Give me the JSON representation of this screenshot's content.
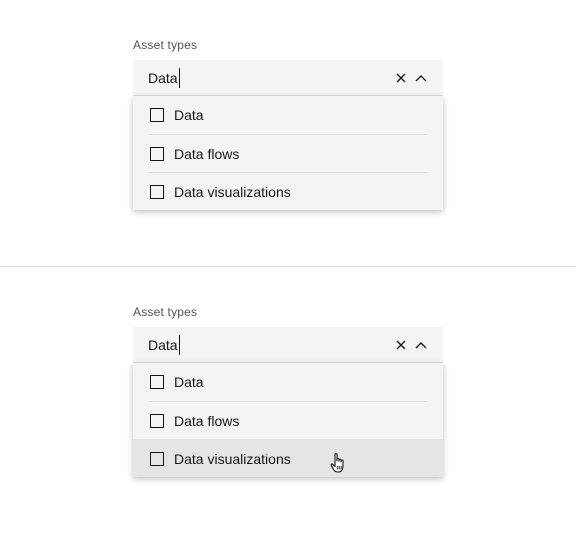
{
  "examples": [
    {
      "label": "Asset types",
      "input_value": "Data",
      "options": [
        {
          "label": "Data",
          "checked": false
        },
        {
          "label": "Data flows",
          "checked": false
        },
        {
          "label": "Data visualizations",
          "checked": false
        }
      ],
      "hovered_index": null
    },
    {
      "label": "Asset types",
      "input_value": "Data",
      "options": [
        {
          "label": "Data",
          "checked": false
        },
        {
          "label": "Data flows",
          "checked": false
        },
        {
          "label": "Data visualizations",
          "checked": false
        }
      ],
      "hovered_index": 2
    }
  ],
  "icons": {
    "clear": "close-icon",
    "toggle": "chevron-up-icon",
    "pointer": "hand-pointer-icon"
  },
  "colors": {
    "field_bg": "#f4f4f4",
    "hover_bg": "#e5e5e5",
    "text": "#161616",
    "label": "#525252",
    "divider": "#e0e0e0"
  }
}
